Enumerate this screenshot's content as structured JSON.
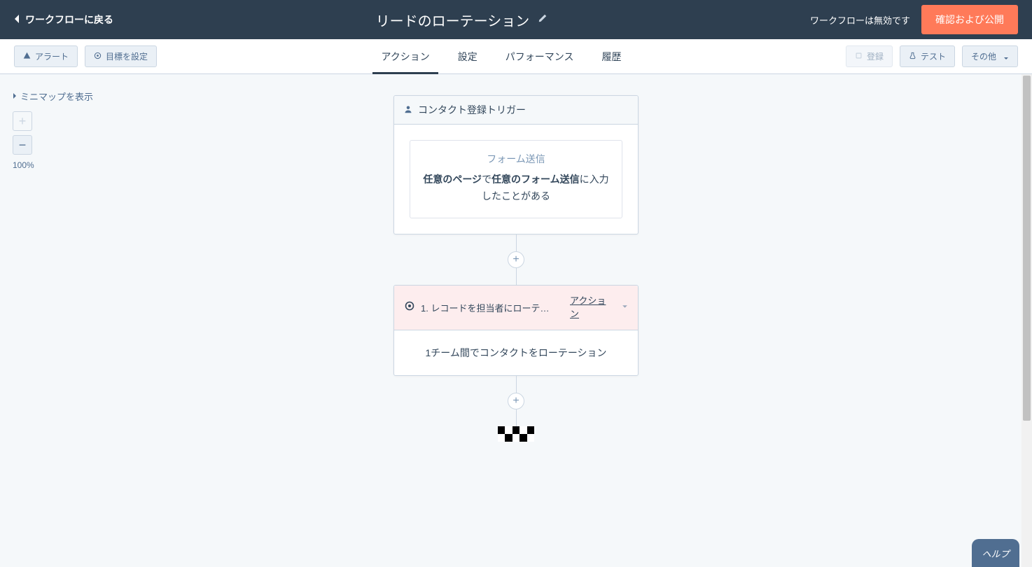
{
  "header": {
    "back_label": "ワークフローに戻る",
    "title": "リードのローテーション",
    "status_text": "ワークフローは無効です",
    "publish_button": "確認および公開"
  },
  "toolbar": {
    "alert_button": "アラート",
    "goal_button": "目標を設定",
    "register_button": "登録",
    "test_button": "テスト",
    "more_button": "その他"
  },
  "tabs": {
    "action": "アクション",
    "settings": "設定",
    "performance": "パフォーマンス",
    "history": "履歴"
  },
  "canvas": {
    "minimap_toggle": "ミニマップを表示",
    "zoom_level": "100%"
  },
  "trigger_card": {
    "header": "コンタクト登録トリガー",
    "inner_title": "フォーム送信",
    "desc_prefix": "任意のページ",
    "desc_mid1": "で",
    "desc_bold2": "任意のフォーム送信",
    "desc_suffix": "に入力したことがある"
  },
  "action_card": {
    "step_label": "1. レコードを担当者にローテ…",
    "action_link": "アクション",
    "body_text": "1チーム間でコンタクトをローテーション"
  },
  "help": {
    "label": "ヘルプ"
  }
}
